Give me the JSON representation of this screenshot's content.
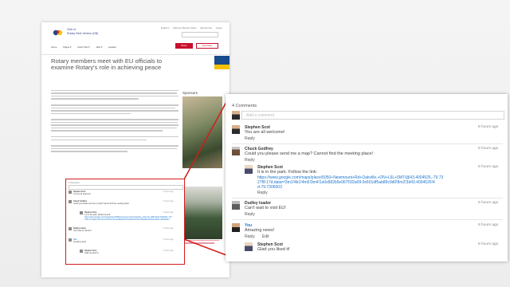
{
  "site": {
    "club_line1": "Club of",
    "club_line2": "Rotary Next Version (DB)",
    "top_links": [
      "English ▾",
      "Welcome Member Option",
      "Member Pay",
      "Logout"
    ],
    "nav": [
      "Home",
      "Pages ▾",
      "South Test ▾",
      "Jack ▾",
      "speaker"
    ],
    "nav_active": "Rotary",
    "nav_outline": "Secondary",
    "headline": "Rotary members meet with EU officials to examine Rotary's role in achieving peace",
    "sponsors_heading": "Sponsors",
    "mini_count": "4 Comments"
  },
  "zoom": {
    "comment_count": "4 Comments",
    "add_placeholder": "Add a comment",
    "comments": [
      {
        "author": "Stephen Scot",
        "time": "8 hours ago",
        "text": "You are all welcome!",
        "reply": "Reply"
      },
      {
        "author": "Chuck Godfrey",
        "time": "8 hours ago",
        "text": "Could you please send me a map? Cannot find the meeting place!",
        "reply": "Reply"
      },
      {
        "author": "Stephen Scot",
        "time": "8 hours ago",
        "text": "It is in the park. Follow the link:",
        "link1": "https://www.google.com/maps/place/5050+Newmount+Rd+Oakville,+ON+L6L+5M7/@43.4004526,-79.73",
        "link2": "27f8:17d.data=!3m1!4b1!4m5!3m4!1s0x882b5e067f1f2a09:0x601df5ab89c9d0!8m2!3d43.4004526!4",
        "link3": "d-79.7306003",
        "reply": "Reply"
      },
      {
        "author": "Dudley Isador",
        "time": "8 hours ago",
        "text": "Can't wait to visit EU!",
        "reply": "Reply"
      },
      {
        "author": "You",
        "time": "8 hours ago",
        "text": "Amazing news!",
        "reply": "Reply",
        "edit": "Edit"
      },
      {
        "author": "Stephen Scot",
        "time": "8 hours ago",
        "text": "Glad you liked it!"
      }
    ]
  },
  "colors": {
    "accent": "#c8102e",
    "link": "#1a75cf",
    "highlight_border": "#d21c1c"
  }
}
